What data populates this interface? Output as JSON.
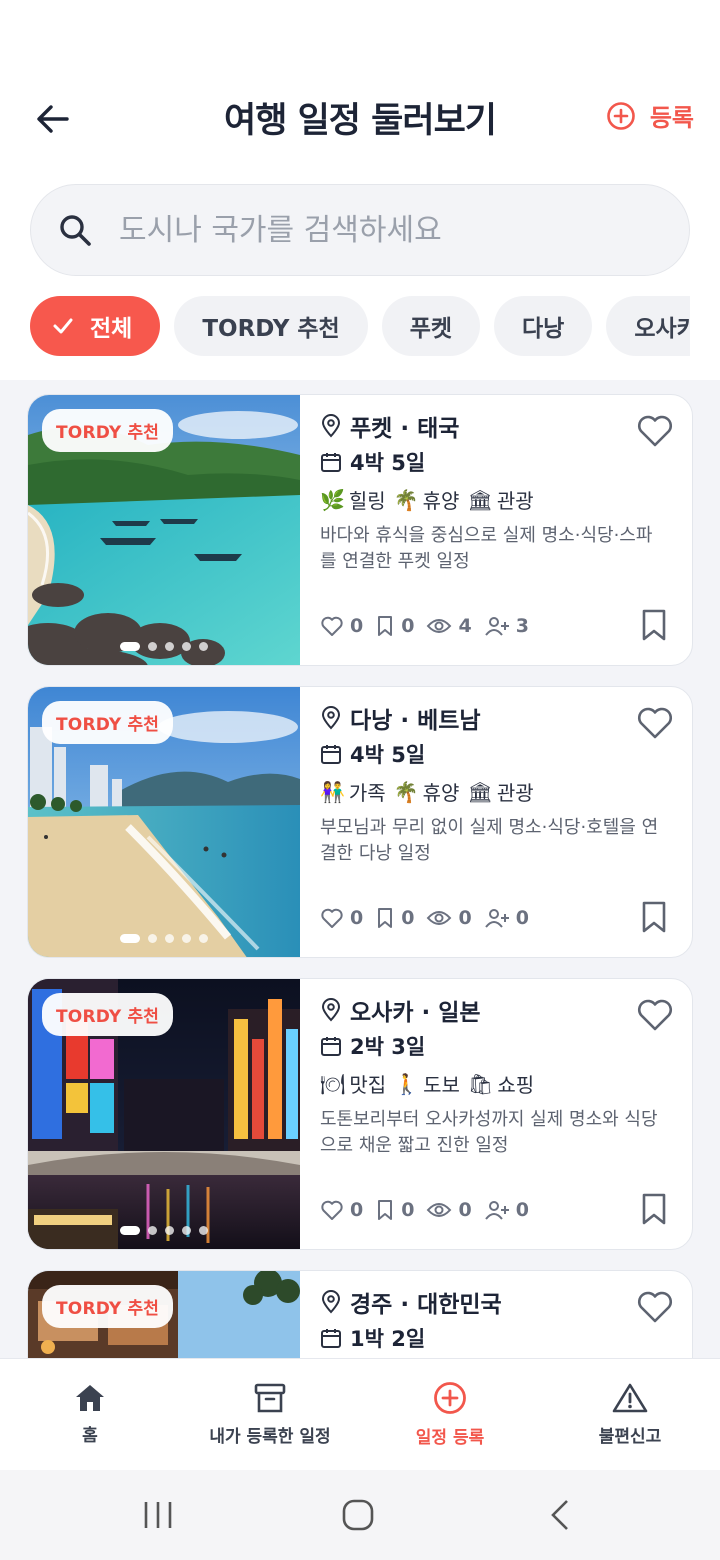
{
  "header": {
    "title": "여행 일정 둘러보기",
    "register_label": "등록"
  },
  "search": {
    "placeholder": "도시나 국가를 검색하세요",
    "value": ""
  },
  "filters": [
    "전체",
    "TORDY 추천",
    "푸켓",
    "다낭",
    "오사카"
  ],
  "active_filter": "전체",
  "cards": [
    {
      "badge": "TORDY 추천",
      "location": "푸켓 · 태국",
      "duration": "4박 5일",
      "tags": [
        {
          "emoji": "🌿",
          "label": "힐링"
        },
        {
          "emoji": "🌴",
          "label": "휴양"
        },
        {
          "emoji": "🏛",
          "label": "관광"
        }
      ],
      "description": "바다와 휴식을 중심으로 실제 명소·식당·스파를 연결한 푸켓 일정",
      "likes": "0",
      "bookmarks": "0",
      "views": "4",
      "participants": "3",
      "image": "beach-turquoise-boats",
      "image_slides": 5
    },
    {
      "badge": "TORDY 추천",
      "location": "다낭 · 베트남",
      "duration": "4박 5일",
      "tags": [
        {
          "emoji": "👫",
          "label": "가족"
        },
        {
          "emoji": "🌴",
          "label": "휴양"
        },
        {
          "emoji": "🏛",
          "label": "관광"
        }
      ],
      "description": "부모님과 무리 없이 실제 명소·식당·호텔을 연결한 다낭 일정",
      "likes": "0",
      "bookmarks": "0",
      "views": "0",
      "participants": "0",
      "image": "city-beach-waves",
      "image_slides": 5
    },
    {
      "badge": "TORDY 추천",
      "location": "오사카 · 일본",
      "duration": "2박 3일",
      "tags": [
        {
          "emoji": "🍽",
          "label": "맛집"
        },
        {
          "emoji": "🚶",
          "label": "도보"
        },
        {
          "emoji": "🛍",
          "label": "쇼핑"
        }
      ],
      "description": "도톤보리부터 오사카성까지 실제 명소와 식당으로 채운 짧고 진한 일정",
      "likes": "0",
      "bookmarks": "0",
      "views": "0",
      "participants": "0",
      "image": "night-canal-neon",
      "image_slides": 5
    },
    {
      "badge": "TORDY 추천",
      "location": "경주 · 대한민국",
      "duration": "1박 2일",
      "image": "traditional-street",
      "image_slides": 5
    }
  ],
  "bottom_nav": [
    {
      "icon": "home-icon",
      "label": "홈"
    },
    {
      "icon": "archive-icon",
      "label": "내가 등록한 일정"
    },
    {
      "icon": "plus-circle-icon",
      "label": "일정 등록",
      "active": true
    },
    {
      "icon": "warning-icon",
      "label": "불편신고"
    }
  ],
  "colors": {
    "accent": "#f7584d",
    "text_dark": "#1d2436",
    "text_muted": "#6b7180",
    "list_bg": "#f3f4f8"
  }
}
